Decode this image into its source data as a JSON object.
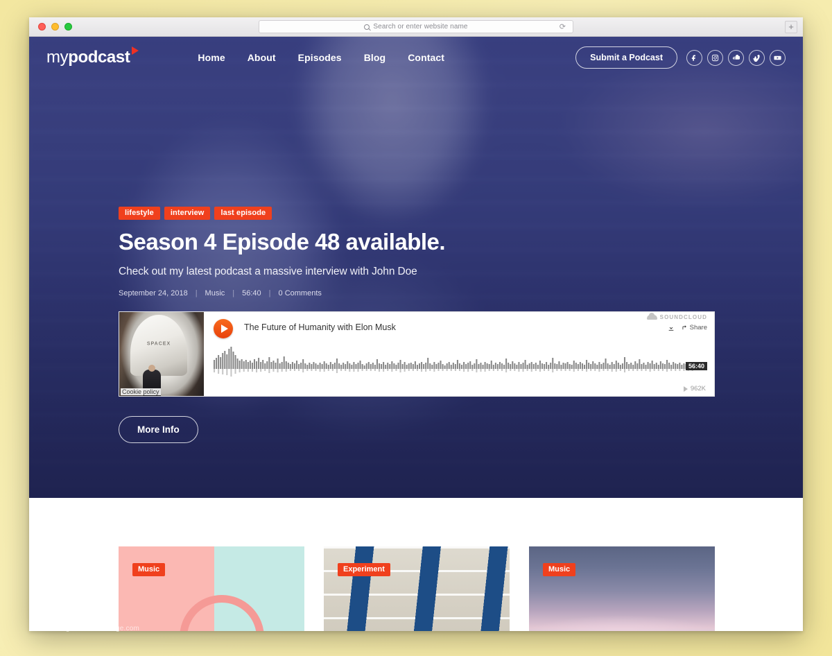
{
  "browser": {
    "search_placeholder": "Search or enter website name",
    "reload_icon": "reload-icon",
    "new_tab_label": "+"
  },
  "site": {
    "logo_light": "my",
    "logo_bold": "podcast"
  },
  "nav": {
    "items": [
      {
        "label": "Home"
      },
      {
        "label": "About"
      },
      {
        "label": "Episodes"
      },
      {
        "label": "Blog"
      },
      {
        "label": "Contact"
      }
    ]
  },
  "header": {
    "submit_label": "Submit a Podcast",
    "socials": [
      {
        "name": "facebook-icon"
      },
      {
        "name": "instagram-icon"
      },
      {
        "name": "soundcloud-icon"
      },
      {
        "name": "vimeo-icon"
      },
      {
        "name": "youtube-icon"
      }
    ]
  },
  "hero": {
    "tags": [
      {
        "label": "lifestyle"
      },
      {
        "label": "interview"
      },
      {
        "label": "last episode"
      }
    ],
    "title": "Season 4 Episode 48 available.",
    "subtitle": "Check out my latest podcast a massive interview with John Doe",
    "meta": {
      "date": "September 24, 2018",
      "category": "Music",
      "duration": "56:40",
      "comments": "0 Comments",
      "separator": "|"
    },
    "cta_label": "More Info"
  },
  "player": {
    "track_title": "The Future of Humanity with Elon Musk",
    "brand": "SOUNDCLOUD",
    "share_label": "Share",
    "download_label": "Download",
    "duration": "56:40",
    "play_count": "962K",
    "cookie_policy": "Cookie policy",
    "artwork_label": "SPACEX"
  },
  "cards": [
    {
      "badge": "Music"
    },
    {
      "badge": "Experiment"
    },
    {
      "badge": "Music"
    }
  ],
  "watermark": "www.heritagechristiancollege.com",
  "colors": {
    "accent": "#f0401d",
    "hero_overlay": "#282c6e",
    "player_play": "#e8410b"
  }
}
